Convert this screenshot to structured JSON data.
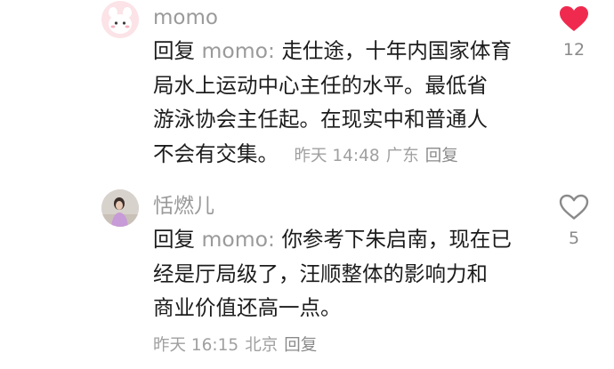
{
  "colors": {
    "like_active": "#F02A4F",
    "like_inactive": "#8a8a8a",
    "muted_text": "#9a9a9a",
    "body_text": "#1c1c1c"
  },
  "comments": [
    {
      "username": "momo",
      "reply_prefix": "回复",
      "reply_to": "momo",
      "text_lines": [
        "走仕途，十年内国家体育",
        "局水上运动中心主任的水平。最低省",
        "游泳协会主任起。在现实中和普通人",
        "不会有交集。"
      ],
      "time": "昨天 14:48",
      "location": "广东",
      "reply_label": "回复",
      "like_count": "12",
      "liked": true,
      "avatar_icon": "cartoon-avatar-icon"
    },
    {
      "username": "恬燃儿",
      "reply_prefix": "回复",
      "reply_to": "momo",
      "text_lines": [
        "你参考下朱启南，现在已",
        "经是厅局级了，汪顺整体的影响力和",
        "商业价值还高一点。"
      ],
      "time": "昨天 16:15",
      "location": "北京",
      "reply_label": "回复",
      "like_count": "5",
      "liked": false,
      "avatar_icon": "photo-avatar-icon"
    }
  ]
}
